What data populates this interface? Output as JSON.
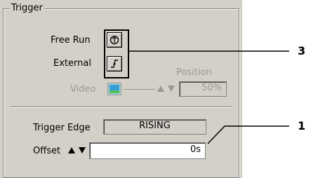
{
  "group": {
    "title": "Trigger"
  },
  "modes": {
    "free_run_label": "Free Run",
    "external_label": "External",
    "video_label": "Video"
  },
  "position": {
    "label": "Position",
    "value": "50%"
  },
  "trigger_edge": {
    "label": "Trigger Edge",
    "value": "RISING"
  },
  "offset": {
    "label": "Offset",
    "value": "0s"
  },
  "callouts": {
    "upper": "3",
    "lower": "1"
  },
  "colors": {
    "panel": "#d4d0c8",
    "disabled_text": "#9a9890",
    "field_bg": "#ffffff"
  },
  "icons": {
    "free_run": "free-run-icon",
    "external": "external-trigger-icon",
    "video": "video-monitor-icon",
    "spin_up": "arrow-up-icon",
    "spin_down": "arrow-down-icon"
  }
}
